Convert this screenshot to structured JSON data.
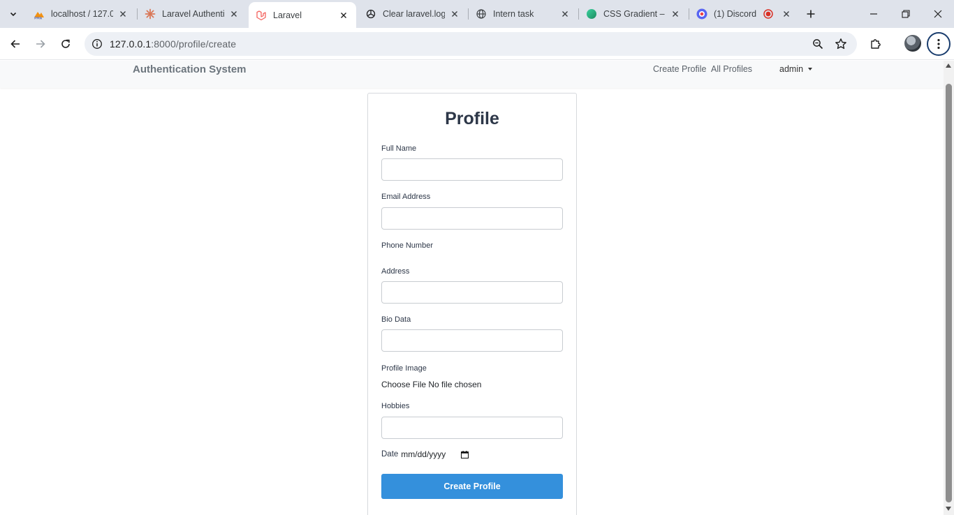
{
  "browser": {
    "tabs": [
      {
        "title": "localhost / 127.0",
        "favicon": "phpmyadmin-icon",
        "active": false
      },
      {
        "title": "Laravel Authentic",
        "favicon": "claude-icon",
        "active": false
      },
      {
        "title": "Laravel",
        "favicon": "laravel-icon",
        "active": true
      },
      {
        "title": "Clear laravel.log",
        "favicon": "chatgpt-icon",
        "active": false
      },
      {
        "title": "Intern task",
        "favicon": "globe-icon",
        "active": false
      },
      {
        "title": "CSS Gradient – C",
        "favicon": "css-gradient-icon",
        "active": false
      },
      {
        "title": "(1) Discord |",
        "favicon": "discord-icon",
        "active": false
      }
    ],
    "url_host": "127.0.0.1",
    "url_path": ":8000/profile/create"
  },
  "navbar": {
    "brand": "Authentication System",
    "links": [
      "Create Profile",
      "All Profiles"
    ],
    "user": "admin"
  },
  "form": {
    "title": "Profile",
    "full_name_label": "Full Name",
    "email_label": "Email Address",
    "phone_label": "Phone Number",
    "address_label": "Address",
    "bio_label": "Bio Data",
    "image_label": "Profile Image",
    "file_button": "Choose File",
    "file_status": "No file chosen",
    "hobbies_label": "Hobbies",
    "date_label": "Date",
    "date_placeholder": "mm/dd/yyyy",
    "submit": "Create Profile"
  },
  "colors": {
    "primary": "#3490dc",
    "navbar_bg": "#f8f9fa",
    "tabstrip_bg": "#dfe3eb"
  }
}
